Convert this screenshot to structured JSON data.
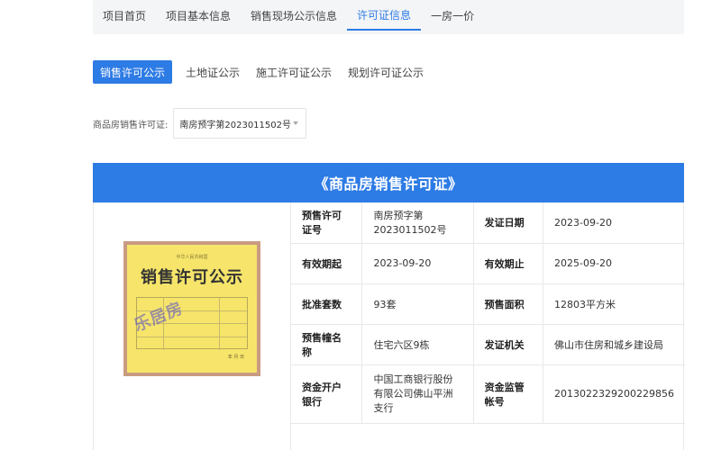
{
  "topnav": {
    "tabs": [
      "项目首页",
      "项目基本信息",
      "销售现场公示信息",
      "许可证信息",
      "一房一价"
    ],
    "active_index": 3
  },
  "subtabs": {
    "items": [
      "销售许可公示",
      "土地证公示",
      "施工许可证公示",
      "规划许可证公示"
    ],
    "active_index": 0
  },
  "filter": {
    "label": "商品房销售许可证:",
    "selected": "南房预字第2023011502号"
  },
  "banner": {
    "title": "《商品房销售许可证》"
  },
  "certificate": {
    "header": "中华人民共和国",
    "title": "销售许可公示",
    "watermark": "乐居房",
    "footer": "年  月  日"
  },
  "info": {
    "rows": [
      {
        "k1": "预售许可证号",
        "v1": "南房预字第2023011502号",
        "k2": "发证日期",
        "v2": "2023-09-20"
      },
      {
        "k1": "有效期起",
        "v1": "2023-09-20",
        "k2": "有效期止",
        "v2": "2025-09-20"
      },
      {
        "k1": "批准套数",
        "v1": "93套",
        "k2": "预售面积",
        "v2": "12803平方米"
      },
      {
        "k1": "预售幢名称",
        "v1": "住宅六区9栋",
        "k2": "发证机关",
        "v2": "佛山市住房和城乡建设局"
      },
      {
        "k1": "资金开户银行",
        "v1": "中国工商银行股份有限公司佛山平洲支行",
        "k2": "资金监管帐号",
        "v2": "2013022329200229856"
      }
    ]
  },
  "colors": {
    "accent": "#2d7be5",
    "nav_bg": "#f4f5f7",
    "cert_yellow": "#f6e56a",
    "cert_frame": "#c99b82"
  }
}
